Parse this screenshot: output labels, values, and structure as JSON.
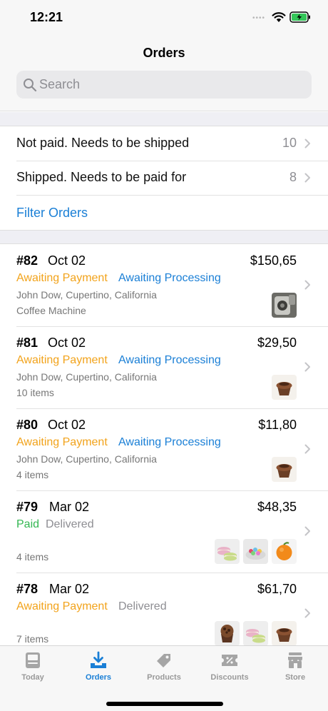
{
  "status_bar": {
    "time": "12:21",
    "dots": "••••",
    "wifi_icon": "wifi-icon",
    "battery_icon": "battery-charging-icon"
  },
  "header": {
    "title": "Orders",
    "search_placeholder": "Search",
    "search_icon": "magnifier-icon"
  },
  "filters": {
    "rows": [
      {
        "label": "Not paid. Needs to be shipped",
        "count": "10"
      },
      {
        "label": "Shipped. Needs to be paid for",
        "count": "8"
      }
    ],
    "link_label": "Filter Orders"
  },
  "colors": {
    "accent_blue": "#1a7fd6",
    "status_orange": "#f2a31b",
    "status_green": "#34b752",
    "status_gray": "#8e8e93"
  },
  "orders": [
    {
      "number": "#82",
      "date": "Oct 02",
      "total": "$150,65",
      "payment_status": "Awaiting Payment",
      "fulfillment_status": "Awaiting Processing",
      "customer": "John Dow, Cupertino, California",
      "items": "Coffee Machine",
      "thumbnails": [
        "coffee-machine"
      ]
    },
    {
      "number": "#81",
      "date": "Oct 02",
      "total": "$29,50",
      "payment_status": "Awaiting Payment",
      "fulfillment_status": "Awaiting Processing",
      "customer": "John Dow, Cupertino, California",
      "items": "10 items",
      "thumbnails": [
        "chocolate-cupcake"
      ]
    },
    {
      "number": "#80",
      "date": "Oct 02",
      "total": "$11,80",
      "payment_status": "Awaiting Payment",
      "fulfillment_status": "Awaiting Processing",
      "customer": "John Dow, Cupertino, California",
      "items": "4 items",
      "thumbnails": [
        "chocolate-cupcake"
      ]
    },
    {
      "number": "#79",
      "date": "Mar 02",
      "total": "$48,35",
      "payment_status": "Paid",
      "fulfillment_status": "Delivered",
      "customer": "",
      "items": "4 items",
      "thumbnails": [
        "macarons",
        "candy-bowl",
        "orange"
      ]
    },
    {
      "number": "#78",
      "date": "Mar 02",
      "total": "$61,70",
      "payment_status": "Awaiting Payment",
      "fulfillment_status": "Delivered",
      "customer": "",
      "items": "7 items",
      "thumbnails": [
        "chocolate-muffin",
        "macarons",
        "chocolate-cupcake"
      ]
    }
  ],
  "tab_bar": {
    "tabs": [
      {
        "label": "Today",
        "icon": "today-icon"
      },
      {
        "label": "Orders",
        "icon": "orders-download-icon"
      },
      {
        "label": "Products",
        "icon": "tag-icon"
      },
      {
        "label": "Discounts",
        "icon": "discount-icon"
      },
      {
        "label": "Store",
        "icon": "store-icon"
      }
    ],
    "active_tab": "Orders"
  }
}
